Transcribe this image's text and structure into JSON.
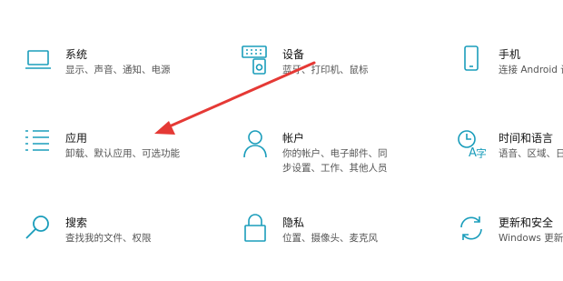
{
  "colors": {
    "accent": "#1a9dbb",
    "annotation_arrow": "#e53935"
  },
  "tiles": {
    "system": {
      "icon": "laptop-icon",
      "title": "系统",
      "desc": "显示、声音、通知、电源"
    },
    "devices": {
      "icon": "devices-icon",
      "title": "设备",
      "desc": "蓝牙、打印机、鼠标"
    },
    "phone": {
      "icon": "phone-icon",
      "title": "手机",
      "desc": "连接 Android 设"
    },
    "apps": {
      "icon": "apps-list-icon",
      "title": "应用",
      "desc": "卸载、默认应用、可选功能"
    },
    "accounts": {
      "icon": "person-icon",
      "title": "帐户",
      "desc": "你的帐户、电子邮件、同步设置、工作、其他人员"
    },
    "time_language": {
      "icon": "time-language-icon",
      "title": "时间和语言",
      "desc": "语音、区域、日"
    },
    "search": {
      "icon": "search-icon",
      "title": "搜索",
      "desc": "查找我的文件、权限"
    },
    "privacy": {
      "icon": "lock-icon",
      "title": "隐私",
      "desc": "位置、摄像头、麦克风"
    },
    "update_security": {
      "icon": "sync-icon",
      "title": "更新和安全",
      "desc": "Windows 更新"
    }
  }
}
